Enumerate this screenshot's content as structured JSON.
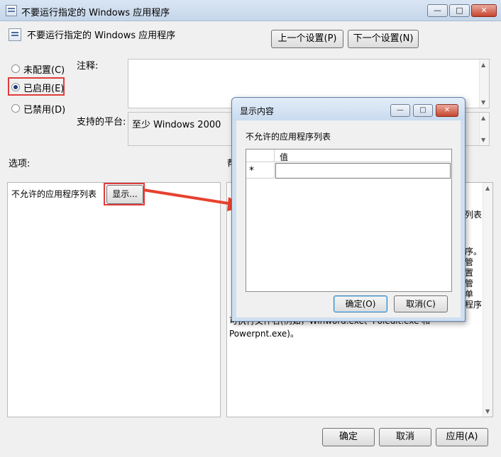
{
  "window": {
    "title": "不要运行指定的 Windows 应用程序",
    "min_glyph": "—",
    "max_glyph": "□",
    "close_glyph": "✕"
  },
  "header": {
    "setting_name": "不要运行指定的 Windows 应用程序",
    "prev_button": "上一个设置(P)",
    "next_button": "下一个设置(N)"
  },
  "state": {
    "options": [
      {
        "label": "未配置(C)",
        "selected": false
      },
      {
        "label": "已启用(E)",
        "selected": true
      },
      {
        "label": "已禁用(D)",
        "selected": false
      }
    ]
  },
  "fields": {
    "comment_label": "注释:",
    "platform_label": "支持的平台:",
    "platform_value": "至少 Windows 2000"
  },
  "options_panel": {
    "label": "选项:",
    "item_label": "不允许的应用程序列表",
    "show_button": "显示..."
  },
  "help_panel": {
    "label": "帮",
    "text_fragment_1": "列表",
    "text_fragment_2": "序。\n管\n置\n管\n单\n程序",
    "text_bottom": "可执行文件名(例如，Winword.exe、Poledit.exe 和 Powerpnt.exe)。"
  },
  "footer": {
    "ok": "确定",
    "cancel": "取消",
    "apply": "应用(A)"
  },
  "dialog": {
    "title": "显示内容",
    "list_label": "不允许的应用程序列表",
    "column_value": "值",
    "new_row_marker": "*",
    "ok": "确定(O)",
    "cancel": "取消(C)"
  },
  "colors": {
    "highlight_red": "#e03c3c",
    "arrow_red": "#e8412f"
  }
}
